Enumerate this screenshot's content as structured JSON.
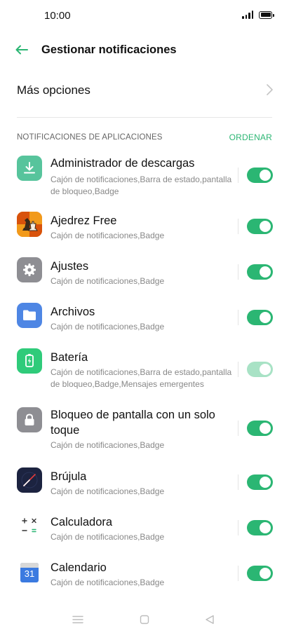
{
  "status_bar": {
    "time": "10:00"
  },
  "header": {
    "title": "Gestionar notificaciones"
  },
  "more_options": {
    "label": "Más opciones"
  },
  "section": {
    "title": "NOTIFICACIONES DE APLICACIONES",
    "sort_label": "ORDENAR"
  },
  "apps": [
    {
      "name": "Administrador de descargas",
      "desc": "Cajón de notificaciones,Barra de estado,pantalla de bloqueo,Badge",
      "enabled": true,
      "icon": "download-icon",
      "color": "#57c49c"
    },
    {
      "name": "Ajedrez Free",
      "desc": "Cajón de notificaciones,Badge",
      "enabled": true,
      "icon": "chess-icon",
      "color": "#e56a12"
    },
    {
      "name": "Ajustes",
      "desc": "Cajón de notificaciones,Badge",
      "enabled": true,
      "icon": "gear-icon",
      "color": "#8e8e93"
    },
    {
      "name": "Archivos",
      "desc": "Cajón de notificaciones,Badge",
      "enabled": true,
      "icon": "folder-icon",
      "color": "#4e86e4"
    },
    {
      "name": "Batería",
      "desc": "Cajón de notificaciones,Barra de estado,pantalla de bloqueo,Badge,Mensajes emergentes",
      "enabled": true,
      "disabled": true,
      "icon": "battery-icon",
      "color": "#2fcb7a"
    },
    {
      "name": "Bloqueo de pantalla con un solo toque",
      "desc": "Cajón de notificaciones,Badge",
      "enabled": true,
      "icon": "lock-icon",
      "color": "#8e8e93"
    },
    {
      "name": "Brújula",
      "desc": "Cajón de notificaciones,Badge",
      "enabled": true,
      "icon": "compass-icon",
      "color": "#1c2340"
    },
    {
      "name": "Calculadora",
      "desc": "Cajón de notificaciones,Badge",
      "enabled": true,
      "icon": "calculator-icon",
      "color": "#ffffff"
    },
    {
      "name": "Calendario",
      "desc": "Cajón de notificaciones,Badge",
      "enabled": true,
      "icon": "calendar-icon",
      "color": "#3b7ae0",
      "icon_text": "31"
    }
  ],
  "nav_bar": {
    "buttons": [
      "menu-icon",
      "home-icon",
      "back-triangle-icon"
    ]
  },
  "accent_color": "#2bb673"
}
